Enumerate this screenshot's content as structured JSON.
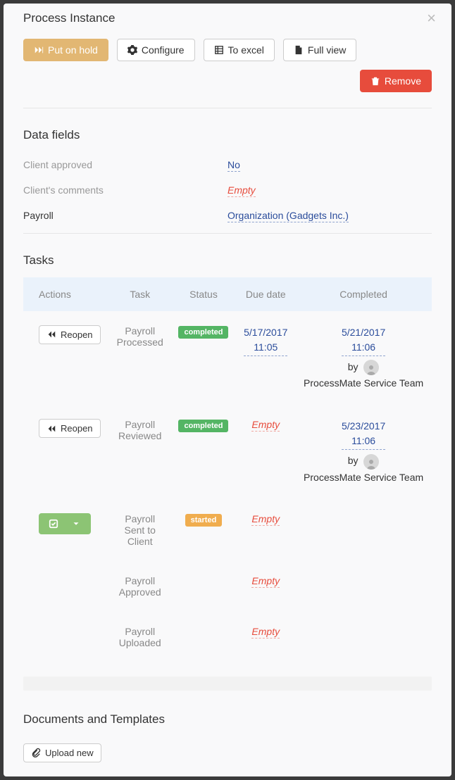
{
  "modal": {
    "title": "Process Instance"
  },
  "toolbar": {
    "put_on_hold": "Put on hold",
    "configure": "Configure",
    "to_excel": "To excel",
    "full_view": "Full view",
    "remove": "Remove"
  },
  "data_fields": {
    "title": "Data fields",
    "rows": [
      {
        "label": "Client approved",
        "value": "No",
        "type": "link"
      },
      {
        "label": "Client's comments",
        "value": "Empty",
        "type": "empty"
      },
      {
        "label": "Payroll",
        "value": "Organization (Gadgets Inc.)",
        "type": "link",
        "label_style": "dark"
      }
    ]
  },
  "tasks": {
    "title": "Tasks",
    "headers": {
      "actions": "Actions",
      "task": "Task",
      "status": "Status",
      "due": "Due date",
      "completed": "Completed"
    },
    "reopen_label": "Reopen",
    "by_label": "by",
    "rows": [
      {
        "action": "reopen",
        "task": "Payroll Processed",
        "status": "completed",
        "due": "5/17/2017 11:05",
        "completed_date": "5/21/2017 11:06",
        "completed_by": "ProcessMate Service Team"
      },
      {
        "action": "reopen",
        "task": "Payroll Reviewed",
        "status": "completed",
        "due": "Empty",
        "due_empty": true,
        "completed_date": "5/23/2017 11:06",
        "completed_by": "ProcessMate Service Team"
      },
      {
        "action": "start-dropdown",
        "task": "Payroll Sent to Client",
        "status": "started",
        "due": "Empty",
        "due_empty": true
      },
      {
        "action": "",
        "task": "Payroll Approved",
        "status": "",
        "due": "Empty",
        "due_empty": true
      },
      {
        "action": "",
        "task": "Payroll Uploaded",
        "status": "",
        "due": "Empty",
        "due_empty": true
      }
    ]
  },
  "documents": {
    "title": "Documents and Templates",
    "upload_label": "Upload new"
  }
}
